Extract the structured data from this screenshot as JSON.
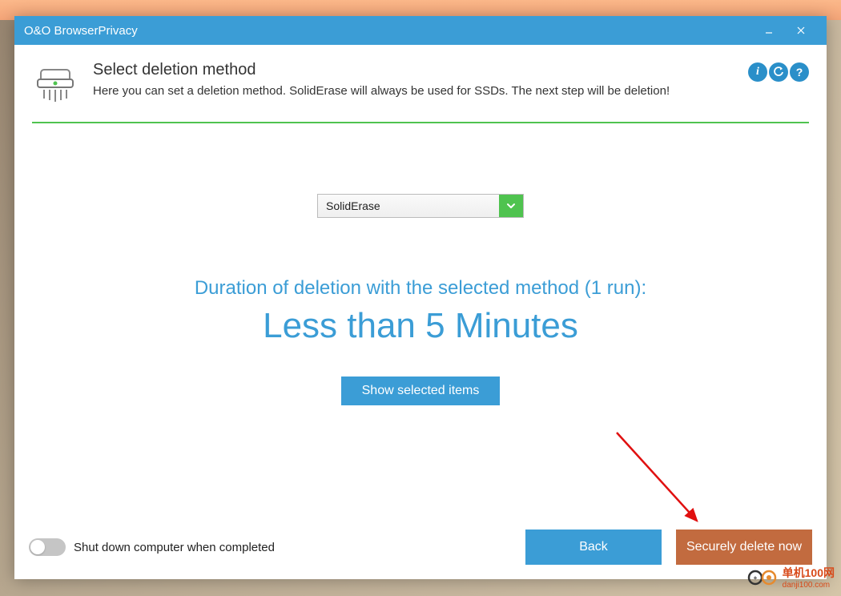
{
  "titlebar": {
    "title": "O&O BrowserPrivacy"
  },
  "header": {
    "title": "Select deletion method",
    "description": "Here you can set a deletion method. SolidErase will always be used for SSDs. The next step will be deletion!",
    "actions": {
      "info": "i",
      "refresh": "↻",
      "help": "?"
    }
  },
  "dropdown": {
    "selected": "SolidErase"
  },
  "duration": {
    "label": "Duration of deletion with the selected method (1 run):",
    "value": "Less than 5 Minutes"
  },
  "buttons": {
    "show_items": "Show selected items",
    "back": "Back",
    "delete": "Securely delete now"
  },
  "footer": {
    "shutdown_label": "Shut down computer when completed"
  },
  "watermark": {
    "text": "单机100网",
    "sub": "danji100.com"
  }
}
